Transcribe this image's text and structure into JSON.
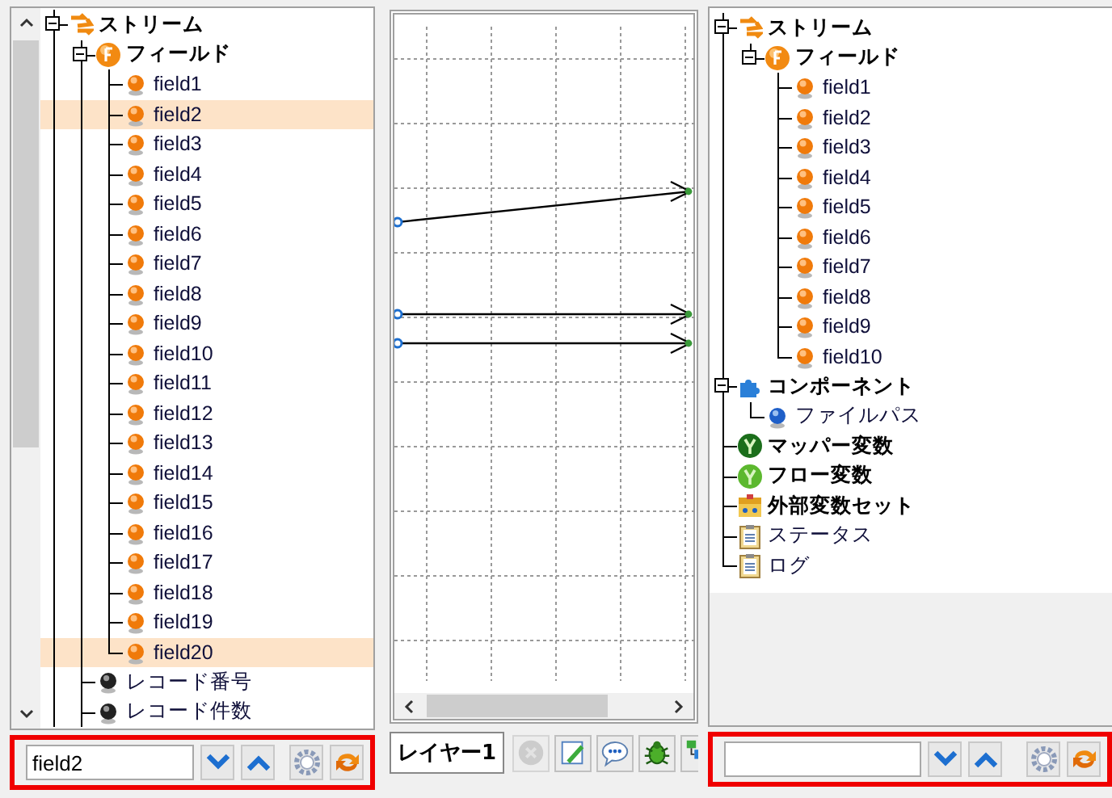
{
  "left_panel": {
    "tree": {
      "continues_below": true,
      "items": [
        {
          "label": "ストリーム",
          "kind": "stream",
          "expanded": true,
          "selected": false,
          "children": [
            {
              "label": "フィールド",
              "kind": "field-group",
              "expanded": true,
              "selected": false,
              "children": [
                {
                  "label": "field1",
                  "kind": "field",
                  "selected": false
                },
                {
                  "label": "field2",
                  "kind": "field",
                  "selected": true
                },
                {
                  "label": "field3",
                  "kind": "field",
                  "selected": false
                },
                {
                  "label": "field4",
                  "kind": "field",
                  "selected": false
                },
                {
                  "label": "field5",
                  "kind": "field",
                  "selected": false
                },
                {
                  "label": "field6",
                  "kind": "field",
                  "selected": false
                },
                {
                  "label": "field7",
                  "kind": "field",
                  "selected": false
                },
                {
                  "label": "field8",
                  "kind": "field",
                  "selected": false
                },
                {
                  "label": "field9",
                  "kind": "field",
                  "selected": false
                },
                {
                  "label": "field10",
                  "kind": "field",
                  "selected": false
                },
                {
                  "label": "field11",
                  "kind": "field",
                  "selected": false
                },
                {
                  "label": "field12",
                  "kind": "field",
                  "selected": false
                },
                {
                  "label": "field13",
                  "kind": "field",
                  "selected": false
                },
                {
                  "label": "field14",
                  "kind": "field",
                  "selected": false
                },
                {
                  "label": "field15",
                  "kind": "field",
                  "selected": false
                },
                {
                  "label": "field16",
                  "kind": "field",
                  "selected": false
                },
                {
                  "label": "field17",
                  "kind": "field",
                  "selected": false
                },
                {
                  "label": "field18",
                  "kind": "field",
                  "selected": false
                },
                {
                  "label": "field19",
                  "kind": "field",
                  "selected": false
                },
                {
                  "label": "field20",
                  "kind": "field",
                  "selected": true
                }
              ]
            },
            {
              "label": "レコード番号",
              "kind": "record",
              "selected": false
            },
            {
              "label": "レコード件数",
              "kind": "record",
              "selected": false
            }
          ]
        }
      ]
    },
    "search": {
      "value": "field2",
      "outlined": true
    }
  },
  "canvas": {
    "layer_tab": "レイヤー1",
    "tools": [
      {
        "kind": "delete",
        "disabled": true
      },
      {
        "kind": "edit",
        "disabled": false
      },
      {
        "kind": "comment",
        "disabled": false
      },
      {
        "kind": "debug",
        "disabled": false
      },
      {
        "kind": "layout",
        "disabled": false
      }
    ]
  },
  "right_panel": {
    "tree": {
      "continues_below": false,
      "items": [
        {
          "label": "ストリーム",
          "kind": "stream",
          "expanded": true,
          "selected": false,
          "children": [
            {
              "label": "フィールド",
              "kind": "field-group",
              "expanded": true,
              "selected": false,
              "children": [
                {
                  "label": "field1",
                  "kind": "field",
                  "selected": false
                },
                {
                  "label": "field2",
                  "kind": "field",
                  "selected": false
                },
                {
                  "label": "field3",
                  "kind": "field",
                  "selected": false
                },
                {
                  "label": "field4",
                  "kind": "field",
                  "selected": false
                },
                {
                  "label": "field5",
                  "kind": "field",
                  "selected": false
                },
                {
                  "label": "field6",
                  "kind": "field",
                  "selected": false
                },
                {
                  "label": "field7",
                  "kind": "field",
                  "selected": false
                },
                {
                  "label": "field8",
                  "kind": "field",
                  "selected": false
                },
                {
                  "label": "field9",
                  "kind": "field",
                  "selected": false
                },
                {
                  "label": "field10",
                  "kind": "field",
                  "selected": false
                }
              ]
            }
          ]
        },
        {
          "label": "コンポーネント",
          "kind": "component",
          "expanded": true,
          "selected": false,
          "children": [
            {
              "label": "ファイルパス",
              "kind": "file-path",
              "selected": false
            }
          ]
        },
        {
          "label": "マッパー変数",
          "kind": "mapper-var",
          "selected": false
        },
        {
          "label": "フロー変数",
          "kind": "flow-var",
          "selected": false
        },
        {
          "label": "外部変数セット",
          "kind": "external-var",
          "selected": false
        },
        {
          "label": "ステータス",
          "kind": "status",
          "selected": false
        },
        {
          "label": "ログ",
          "kind": "log",
          "selected": false
        }
      ]
    },
    "search": {
      "outlined": true
    }
  }
}
